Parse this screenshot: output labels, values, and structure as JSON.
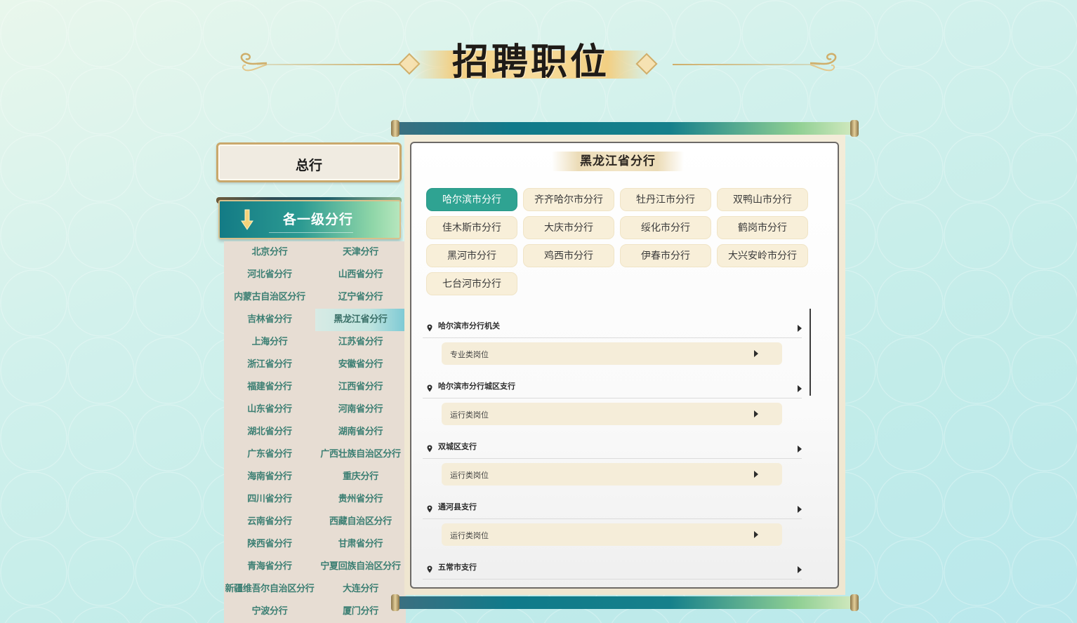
{
  "page": {
    "title": "招聘职位"
  },
  "head_office": {
    "label": "总行"
  },
  "branch_section": {
    "title": "各一级分行",
    "items": [
      {
        "label": "北京分行",
        "active": false
      },
      {
        "label": "天津分行",
        "active": false
      },
      {
        "label": "河北省分行",
        "active": false
      },
      {
        "label": "山西省分行",
        "active": false
      },
      {
        "label": "内蒙古自治区分行",
        "active": false
      },
      {
        "label": "辽宁省分行",
        "active": false
      },
      {
        "label": "吉林省分行",
        "active": false
      },
      {
        "label": "黑龙江省分行",
        "active": true
      },
      {
        "label": "上海分行",
        "active": false
      },
      {
        "label": "江苏省分行",
        "active": false
      },
      {
        "label": "浙江省分行",
        "active": false
      },
      {
        "label": "安徽省分行",
        "active": false
      },
      {
        "label": "福建省分行",
        "active": false
      },
      {
        "label": "江西省分行",
        "active": false
      },
      {
        "label": "山东省分行",
        "active": false
      },
      {
        "label": "河南省分行",
        "active": false
      },
      {
        "label": "湖北省分行",
        "active": false
      },
      {
        "label": "湖南省分行",
        "active": false
      },
      {
        "label": "广东省分行",
        "active": false
      },
      {
        "label": "广西壮族自治区分行",
        "active": false
      },
      {
        "label": "海南省分行",
        "active": false
      },
      {
        "label": "重庆分行",
        "active": false
      },
      {
        "label": "四川省分行",
        "active": false
      },
      {
        "label": "贵州省分行",
        "active": false
      },
      {
        "label": "云南省分行",
        "active": false
      },
      {
        "label": "西藏自治区分行",
        "active": false
      },
      {
        "label": "陕西省分行",
        "active": false
      },
      {
        "label": "甘肃省分行",
        "active": false
      },
      {
        "label": "青海省分行",
        "active": false
      },
      {
        "label": "宁夏回族自治区分行",
        "active": false
      },
      {
        "label": "新疆维吾尔自治区分行",
        "active": false
      },
      {
        "label": "大连分行",
        "active": false
      },
      {
        "label": "宁波分行",
        "active": false
      },
      {
        "label": "厦门分行",
        "active": false
      }
    ]
  },
  "province_panel": {
    "title": "黑龙江省分行",
    "cities": [
      {
        "label": "哈尔滨市分行",
        "active": true
      },
      {
        "label": "齐齐哈尔市分行",
        "active": false
      },
      {
        "label": "牡丹江市分行",
        "active": false
      },
      {
        "label": "双鸭山市分行",
        "active": false
      },
      {
        "label": "佳木斯市分行",
        "active": false
      },
      {
        "label": "大庆市分行",
        "active": false
      },
      {
        "label": "绥化市分行",
        "active": false
      },
      {
        "label": "鹤岗市分行",
        "active": false
      },
      {
        "label": "黑河市分行",
        "active": false
      },
      {
        "label": "鸡西市分行",
        "active": false
      },
      {
        "label": "伊春市分行",
        "active": false
      },
      {
        "label": "大兴安岭市分行",
        "active": false
      },
      {
        "label": "七台河市分行",
        "active": false
      }
    ],
    "orgs": [
      {
        "name": "哈尔滨市分行机关",
        "positions": [
          "专业类岗位"
        ]
      },
      {
        "name": "哈尔滨市分行城区支行",
        "positions": [
          "运行类岗位"
        ]
      },
      {
        "name": "双城区支行",
        "positions": [
          "运行类岗位"
        ]
      },
      {
        "name": "通河县支行",
        "positions": [
          "运行类岗位"
        ]
      },
      {
        "name": "五常市支行",
        "positions": []
      }
    ]
  },
  "colors": {
    "accent_teal": "#2fa392",
    "branch_text": "#3c7f73",
    "gold": "#cfae6a",
    "city_button_bg": "#f8efd9"
  },
  "icons": {
    "location": "map-pin-icon",
    "expand": "caret-right-icon",
    "section_arrow": "chevron-down-arrow-icon"
  }
}
